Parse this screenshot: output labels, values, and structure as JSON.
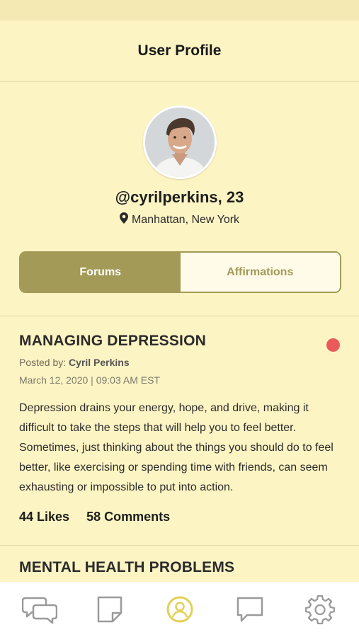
{
  "header": {
    "title": "User Profile"
  },
  "profile": {
    "username_line": "@cyrilperkins, 23",
    "location": "Manhattan, New York",
    "location_icon": "map-pin-icon"
  },
  "tabs": [
    {
      "label": "Forums",
      "active": true
    },
    {
      "label": "Affirmations",
      "active": false
    }
  ],
  "posts": [
    {
      "title": "MANAGING DEPRESSION",
      "posted_by_label": "Posted by:",
      "author": "Cyril Perkins",
      "date": "March 12, 2020 | 09:03 AM EST",
      "body": "Depression drains your energy, hope, and drive, making it difficult to take the steps that will help you to feel better. Sometimes, just thinking about the things you should do to feel better, like exercising or spending time with friends, can seem exhausting or impossible to put into action.",
      "likes": "44 Likes",
      "comments": "58 Comments",
      "unread": true
    },
    {
      "title": "MENTAL HEALTH PROBLEMS"
    }
  ],
  "bottom_nav": [
    {
      "icon": "chat-bubbles-icon",
      "active": false
    },
    {
      "icon": "note-icon",
      "active": false
    },
    {
      "icon": "profile-icon",
      "active": true
    },
    {
      "icon": "message-icon",
      "active": false
    },
    {
      "icon": "gear-icon",
      "active": false
    }
  ],
  "colors": {
    "background": "#fdf4c4",
    "accent": "#a39a58",
    "active_nav": "#e3cf55",
    "inactive_nav": "#9a9a9a",
    "unread_dot": "#e95a5a"
  }
}
